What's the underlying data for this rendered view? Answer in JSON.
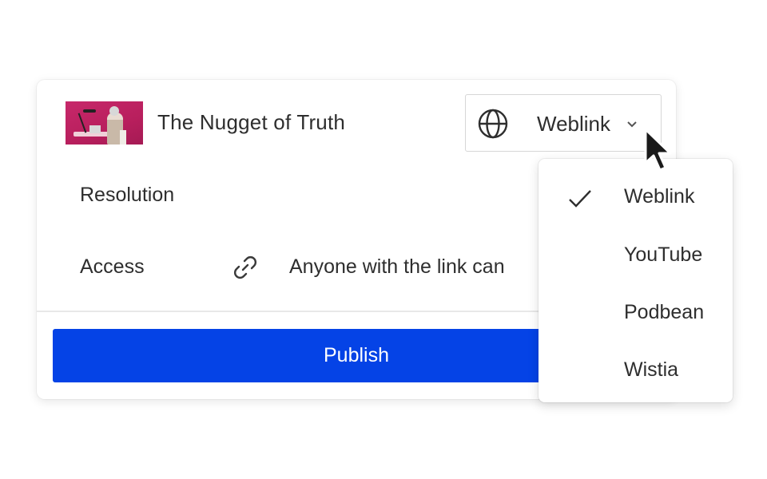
{
  "media": {
    "title": "The Nugget of Truth",
    "thumbnail": "video-thumbnail"
  },
  "destination": {
    "selected": "Weblink",
    "icon": "globe-icon",
    "dropdown_icon": "chevron-down-icon"
  },
  "settings": {
    "resolution_label": "Resolution",
    "access_label": "Access",
    "access_icon": "link-icon",
    "access_value": "Anyone with the link can"
  },
  "publish_label": "Publish",
  "menu": {
    "items": [
      {
        "label": "Weblink",
        "checked": true
      },
      {
        "label": "YouTube",
        "checked": false
      },
      {
        "label": "Podbean",
        "checked": false
      },
      {
        "label": "Wistia",
        "checked": false
      }
    ]
  },
  "colors": {
    "accent": "#0543e6",
    "thumbnail_bg": "#c7286a"
  }
}
